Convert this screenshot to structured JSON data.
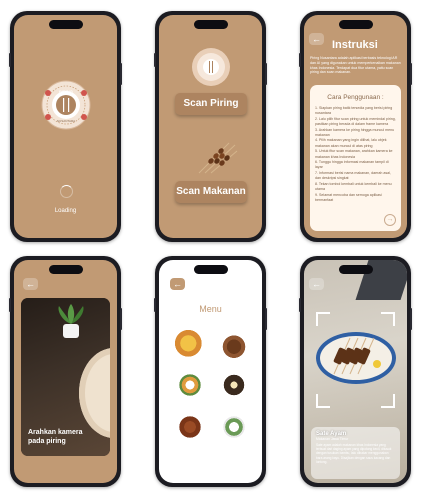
{
  "screens": {
    "loading": {
      "status_text": "Loading",
      "logo_top": "PIRING",
      "logo_bottom": "NUSANTARA"
    },
    "home": {
      "scan_plate_label": "Scan Piring",
      "scan_food_label": "Scan Makanan"
    },
    "instructions": {
      "title": "Instruksi",
      "intro": "Piring Nusantara adalah aplikasi berbasis teknologi AR dan AI yang digunakan untuk memperkenalkan makanan khas Indonesia. Terdapat dua fitur utama, yaitu scan piring dan scan makanan.",
      "usage_title": "Cara Penggunaan :",
      "steps": [
        "1. Siapkan piring batik tersedia yang berisi piring nusantara",
        "2. Lalu pilih fitur scan piring untuk memindai piring, pastikan piring berada di dalam frame kamera",
        "3. Arahkan kamera ke piring hingga muncul menu makanan",
        "4. Pilih makanan yang ingin dilihat, lalu objek makanan akan muncul di atas piring",
        "5. Untuk fitur scan makanan, arahkan kamera ke makanan khas Indonesia",
        "6. Tunggu hingga informasi makanan tampil di layar",
        "7. Informasi berisi nama makanan, daerah asal, dan deskripsi singkat",
        "8. Tekan tombol kembali untuk kembali ke menu utama",
        "9. Selamat mencoba dan semoga aplikasi bermanfaat"
      ]
    },
    "camera": {
      "hint": "Arahkan kamera pada piring"
    },
    "menu": {
      "title": "Menu"
    },
    "result": {
      "food_name": "Sate Ayam",
      "food_origin": "Makanan Jawa Timur",
      "description": "Sate ayam adalah makanan khas Indonesia yang terbuat dari daging ayam yang dipotong kecil, ditusuk dengan tusukan bambu, lalu dibakar menggunakan bara arang kayu. Disajikan dengan saus kacang dan lontong."
    }
  },
  "colors": {
    "brown": "#c19a74",
    "dark_brown": "#ad8460",
    "cream": "#fff6ec"
  }
}
